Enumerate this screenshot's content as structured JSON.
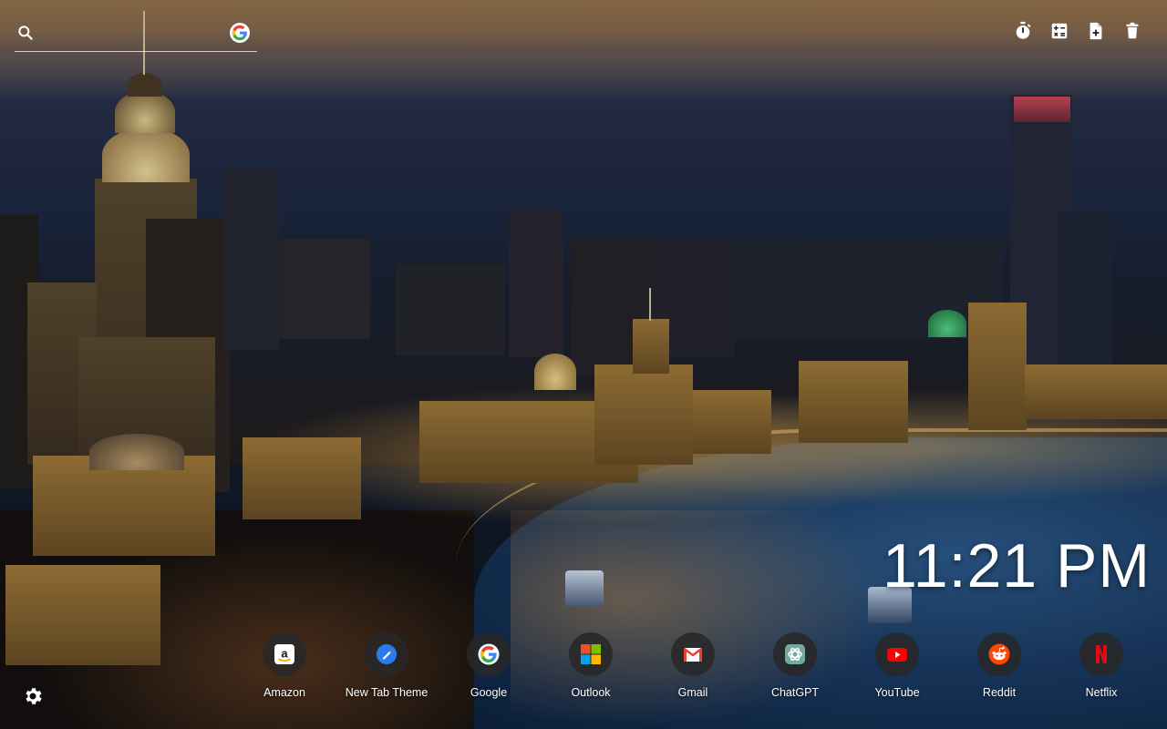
{
  "search": {
    "placeholder": ""
  },
  "toolbar": {
    "items": [
      {
        "icon": "timer-icon"
      },
      {
        "icon": "calculator-icon"
      },
      {
        "icon": "add-file-icon"
      },
      {
        "icon": "trash-icon"
      }
    ]
  },
  "clock": {
    "time": "11:21 PM"
  },
  "shortcuts": [
    {
      "label": "Amazon",
      "icon": "amazon-icon",
      "color": "#ffffff"
    },
    {
      "label": "New Tab Theme",
      "icon": "new-tab-theme-icon",
      "color": "#2a7bf0"
    },
    {
      "label": "Google",
      "icon": "google-icon",
      "color": "#4285f4"
    },
    {
      "label": "Outlook",
      "icon": "windows-icon",
      "color": "#f25022"
    },
    {
      "label": "Gmail",
      "icon": "gmail-icon",
      "color": "#ea4335"
    },
    {
      "label": "ChatGPT",
      "icon": "chatgpt-icon",
      "color": "#74aa9c"
    },
    {
      "label": "YouTube",
      "icon": "youtube-icon",
      "color": "#ff0000"
    },
    {
      "label": "Reddit",
      "icon": "reddit-icon",
      "color": "#ff4500"
    },
    {
      "label": "Netflix",
      "icon": "netflix-icon",
      "color": "#e50914"
    }
  ]
}
